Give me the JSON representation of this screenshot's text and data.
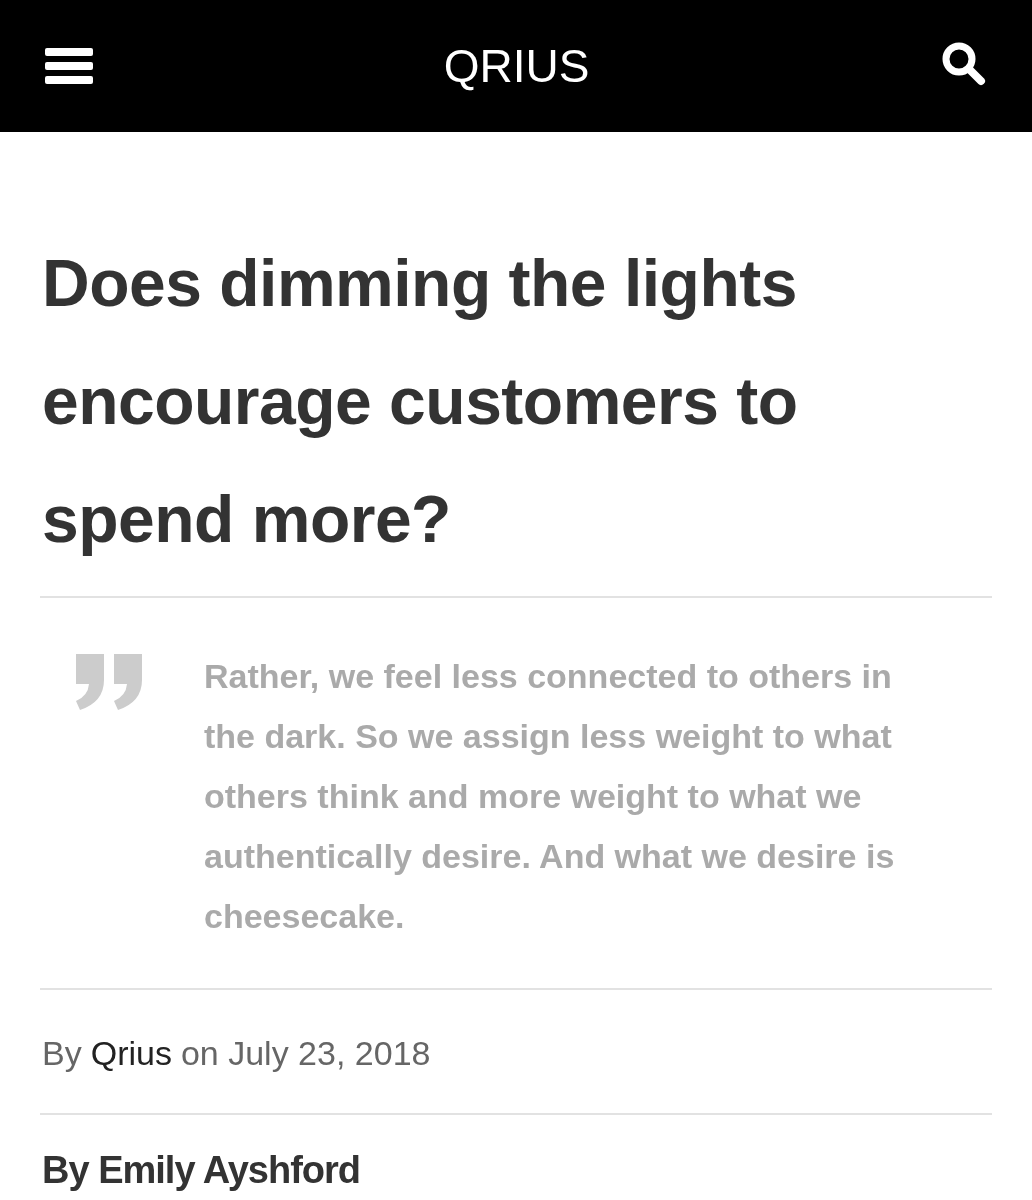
{
  "header": {
    "title": "QRIUS"
  },
  "article": {
    "title": "Does dimming the lights encourage customers to spend more?",
    "quote": "Rather, we feel less connected to others in the dark. So we assign less weight to what others think and more weight to what we authentically desire. And what we desire is cheesecake.",
    "byline": {
      "prefix": "By",
      "author": "Qrius",
      "date": "on July 23, 2018"
    },
    "author_line": "By Emily Ayshford"
  }
}
